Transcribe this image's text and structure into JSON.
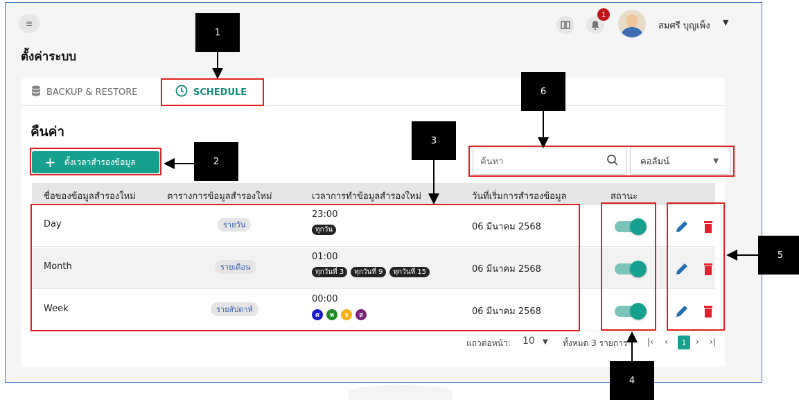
{
  "header": {
    "menu_icon": "menu-collapse-icon",
    "title": "ตั้งค่าระบบ",
    "notification_count": "1",
    "user_name": "สมศรี บุญเพ็ง"
  },
  "tabs": [
    {
      "label": "BACKUP & RESTORE",
      "icon": "database-icon"
    },
    {
      "label": "SCHEDULE",
      "icon": "clock-icon"
    }
  ],
  "section": {
    "title": "คืนค่า",
    "add_button_label": "ตั้งเวลาสำรองข้อมูล",
    "search_placeholder": "ค้นหา",
    "column_select": "คอลัมน์"
  },
  "table": {
    "headers": [
      "ชื่อของข้อมูลสำรองใหม่",
      "ตารางการข้อมูลสำรองใหม่",
      "เวลาการทำข้อมูลสำรองใหม่",
      "วันที่เริ่มการสำรองข้อมูล",
      "สถานะ"
    ],
    "rows": [
      {
        "name": "Day",
        "schedule": "รายวัน",
        "time": "23:00",
        "days": [
          "ทุกวัน"
        ],
        "start": "06 มีนาคม 2568",
        "enabled": true
      },
      {
        "name": "Month",
        "schedule": "รายเดือน",
        "time": "01:00",
        "days": [
          "ทุกวันที่ 3",
          "ทุกวันที่ 9",
          "ทุกวันที่ 15"
        ],
        "start": "06 มีนาคม 2568",
        "enabled": true
      },
      {
        "name": "Week",
        "schedule": "รายสัปดาห์",
        "time": "00:00",
        "weekdays": [
          {
            "label": "ศ",
            "color": "#1a1acc"
          },
          {
            "label": "พ",
            "color": "#1f8a2a"
          },
          {
            "label": "จ",
            "color": "#f2b213"
          },
          {
            "label": "ส",
            "color": "#7a1f7a"
          }
        ],
        "start": "06 มีนาคม 2568",
        "enabled": true
      }
    ]
  },
  "footer": {
    "rows_per_page_label": "แถวต่อหน้า:",
    "rows_per_page": "10",
    "total_label": "ทั้งหมด 3 รายการ",
    "current_page": "1"
  },
  "callouts": [
    "1",
    "2",
    "3",
    "4",
    "5",
    "6"
  ],
  "colors": {
    "accent": "#18a08e",
    "annotation": "#e02020",
    "delete": "#e0202a",
    "edit": "#1f6fb5"
  }
}
